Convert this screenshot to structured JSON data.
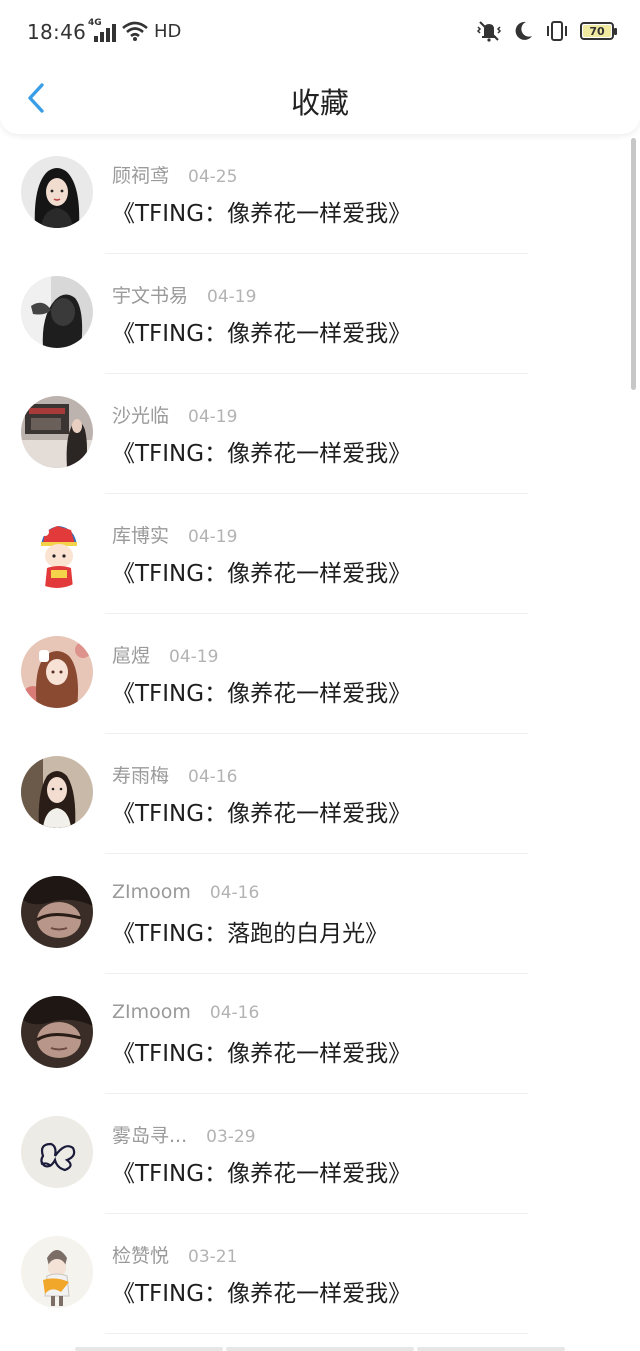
{
  "status": {
    "time": "18:46",
    "network_type": "4G",
    "hd_label": "HD",
    "battery_level": "70",
    "icons": [
      "signal-icon",
      "wifi-icon",
      "mute-vibrate-icon",
      "moon-icon",
      "vibrate-icon",
      "battery-icon"
    ]
  },
  "nav": {
    "title": "收藏",
    "back_icon": "chevron-left-icon",
    "accent_color": "#3a9ee6"
  },
  "items": [
    {
      "username": "顾祠鸢",
      "date": "04-25",
      "title": "《TFING：像养花一样爱我》",
      "avatar_bg": "#3b3b3b"
    },
    {
      "username": "宇文书易",
      "date": "04-19",
      "title": "《TFING：像养花一样爱我》",
      "avatar_bg": "#2e2e2e"
    },
    {
      "username": "沙光临",
      "date": "04-19",
      "title": "《TFING：像养花一样爱我》",
      "avatar_bg": "#a89d98"
    },
    {
      "username": "库博实",
      "date": "04-19",
      "title": "《TFING：像养花一样爱我》",
      "avatar_bg": "#ffffff"
    },
    {
      "username": "扈煜",
      "date": "04-19",
      "title": "《TFING：像养花一样爱我》",
      "avatar_bg": "#c79a88"
    },
    {
      "username": "寿雨梅",
      "date": "04-16",
      "title": "《TFING：像养花一样爱我》",
      "avatar_bg": "#9a8472"
    },
    {
      "username": "ZImoom",
      "date": "04-16",
      "title": "《TFING：落跑的白月光》",
      "avatar_bg": "#4a3a34"
    },
    {
      "username": "ZImoom",
      "date": "04-16",
      "title": "《TFING：像养花一样爱我》",
      "avatar_bg": "#4a3a34"
    },
    {
      "username": "雾岛寻...",
      "date": "03-29",
      "title": "《TFING：像养花一样爱我》",
      "avatar_bg": "#ecebe6"
    },
    {
      "username": "检赞悦",
      "date": "03-21",
      "title": "《TFING：像养花一样爱我》",
      "avatar_bg": "#f5f3ee"
    }
  ]
}
